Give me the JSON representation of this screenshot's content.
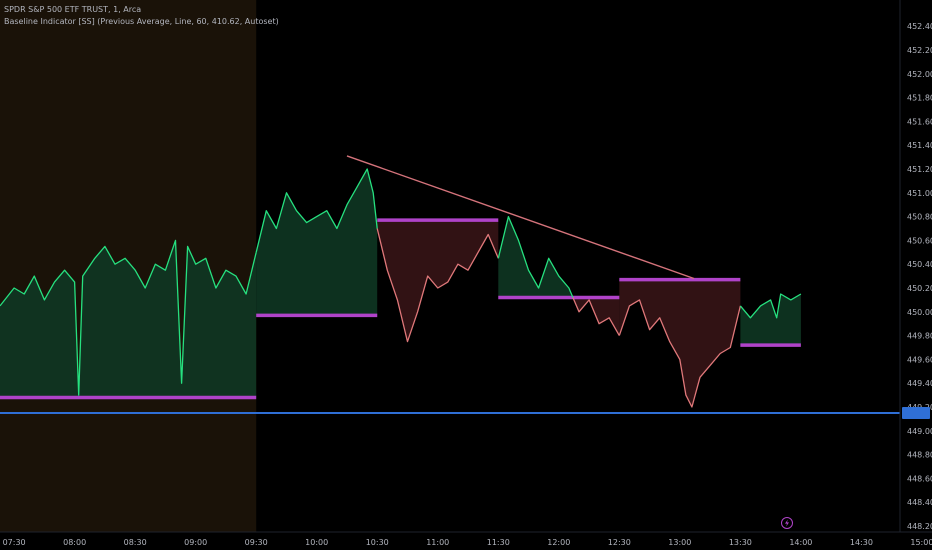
{
  "legend": {
    "symbol_line": "SPDR S&P 500 ETF TRUST, 1, Arca",
    "indicator_line": "Baseline Indicator [SS] (Previous Average, Line, 60, 410.62, Autoset)"
  },
  "colors": {
    "background": "#000000",
    "premarket_bg": "#1a1208",
    "up_line": "#26e07f",
    "down_line": "#e0787a",
    "up_fill": "#0f3a25",
    "down_fill": "#3a1518",
    "baseline": "#b043c9",
    "trendline": "#d4737b",
    "horizontal_line": "#2f6fd6",
    "axis_text": "#b2b5be"
  },
  "lightning_icon": "lightning-icon",
  "chart_data": {
    "type": "line",
    "title": "SPDR S&P 500 ETF TRUST, 1, Arca",
    "y_axis_side": "right",
    "ylim": [
      448.15,
      452.62
    ],
    "y_ticks": [
      "452.40",
      "452.20",
      "452.00",
      "451.80",
      "451.60",
      "451.40",
      "451.20",
      "451.00",
      "450.80",
      "450.60",
      "450.40",
      "450.20",
      "450.00",
      "449.80",
      "449.60",
      "449.40",
      "449.20",
      "449.00",
      "448.80",
      "448.60",
      "448.40",
      "448.20"
    ],
    "x_ticks": [
      "07:30",
      "08:00",
      "08:30",
      "09:00",
      "09:30",
      "10:00",
      "10:30",
      "11:00",
      "11:30",
      "12:00",
      "12:30",
      "13:00",
      "13:30",
      "14:00",
      "14:30",
      "15:00"
    ],
    "x_range": [
      "07:23",
      "15:05"
    ],
    "premarket_shaded": [
      "07:23",
      "09:30"
    ],
    "horizontal_line": 449.15,
    "series": [
      {
        "points": [
          [
            "07:23",
            450.05
          ],
          [
            "07:30",
            450.2
          ],
          [
            "07:35",
            450.15
          ],
          [
            "07:40",
            450.3
          ],
          [
            "07:45",
            450.1
          ],
          [
            "07:50",
            450.25
          ],
          [
            "07:55",
            450.35
          ],
          [
            "08:00",
            450.25
          ],
          [
            "08:02",
            449.3
          ],
          [
            "08:04",
            450.3
          ],
          [
            "08:10",
            450.45
          ],
          [
            "08:15",
            450.55
          ],
          [
            "08:20",
            450.4
          ],
          [
            "08:25",
            450.45
          ],
          [
            "08:30",
            450.35
          ],
          [
            "08:35",
            450.2
          ],
          [
            "08:40",
            450.4
          ],
          [
            "08:45",
            450.35
          ],
          [
            "08:50",
            450.6
          ],
          [
            "08:53",
            449.4
          ],
          [
            "08:56",
            450.55
          ],
          [
            "09:00",
            450.4
          ],
          [
            "09:05",
            450.45
          ],
          [
            "09:10",
            450.2
          ],
          [
            "09:15",
            450.35
          ],
          [
            "09:20",
            450.3
          ],
          [
            "09:25",
            450.15
          ],
          [
            "09:30",
            450.5
          ],
          [
            "09:35",
            450.85
          ],
          [
            "09:40",
            450.7
          ],
          [
            "09:45",
            451.0
          ],
          [
            "09:50",
            450.85
          ],
          [
            "09:55",
            450.75
          ],
          [
            "10:00",
            450.8
          ],
          [
            "10:05",
            450.85
          ],
          [
            "10:10",
            450.7
          ],
          [
            "10:15",
            450.9
          ],
          [
            "10:20",
            451.05
          ],
          [
            "10:25",
            451.2
          ],
          [
            "10:28",
            451.0
          ],
          [
            "10:30",
            450.7
          ],
          [
            "10:35",
            450.35
          ],
          [
            "10:40",
            450.1
          ],
          [
            "10:45",
            449.75
          ],
          [
            "10:50",
            450.0
          ],
          [
            "10:55",
            450.3
          ],
          [
            "11:00",
            450.2
          ],
          [
            "11:05",
            450.25
          ],
          [
            "11:10",
            450.4
          ],
          [
            "11:15",
            450.35
          ],
          [
            "11:20",
            450.5
          ],
          [
            "11:25",
            450.65
          ],
          [
            "11:30",
            450.45
          ],
          [
            "11:35",
            450.8
          ],
          [
            "11:40",
            450.6
          ],
          [
            "11:45",
            450.35
          ],
          [
            "11:50",
            450.2
          ],
          [
            "11:55",
            450.45
          ],
          [
            "12:00",
            450.3
          ],
          [
            "12:05",
            450.2
          ],
          [
            "12:10",
            450.0
          ],
          [
            "12:15",
            450.1
          ],
          [
            "12:20",
            449.9
          ],
          [
            "12:25",
            449.95
          ],
          [
            "12:30",
            449.8
          ],
          [
            "12:35",
            450.05
          ],
          [
            "12:40",
            450.1
          ],
          [
            "12:45",
            449.85
          ],
          [
            "12:50",
            449.95
          ],
          [
            "12:55",
            449.75
          ],
          [
            "13:00",
            449.6
          ],
          [
            "13:03",
            449.3
          ],
          [
            "13:06",
            449.2
          ],
          [
            "13:10",
            449.45
          ],
          [
            "13:15",
            449.55
          ],
          [
            "13:20",
            449.65
          ],
          [
            "13:25",
            449.7
          ],
          [
            "13:30",
            450.05
          ],
          [
            "13:35",
            449.95
          ],
          [
            "13:40",
            450.05
          ],
          [
            "13:45",
            450.1
          ],
          [
            "13:48",
            449.95
          ],
          [
            "13:50",
            450.15
          ],
          [
            "13:55",
            450.1
          ],
          [
            "14:00",
            450.15
          ]
        ]
      }
    ],
    "baselines": [
      {
        "start": "07:23",
        "end": "09:30",
        "value": 449.28
      },
      {
        "start": "09:30",
        "end": "10:30",
        "value": 449.97
      },
      {
        "start": "10:30",
        "end": "11:30",
        "value": 450.77
      },
      {
        "start": "11:30",
        "end": "12:30",
        "value": 450.12
      },
      {
        "start": "12:30",
        "end": "13:30",
        "value": 450.27
      },
      {
        "start": "13:30",
        "end": "14:00",
        "value": 449.72
      }
    ],
    "trendline": [
      [
        "10:15",
        451.31
      ],
      [
        "13:07",
        450.28
      ]
    ]
  }
}
